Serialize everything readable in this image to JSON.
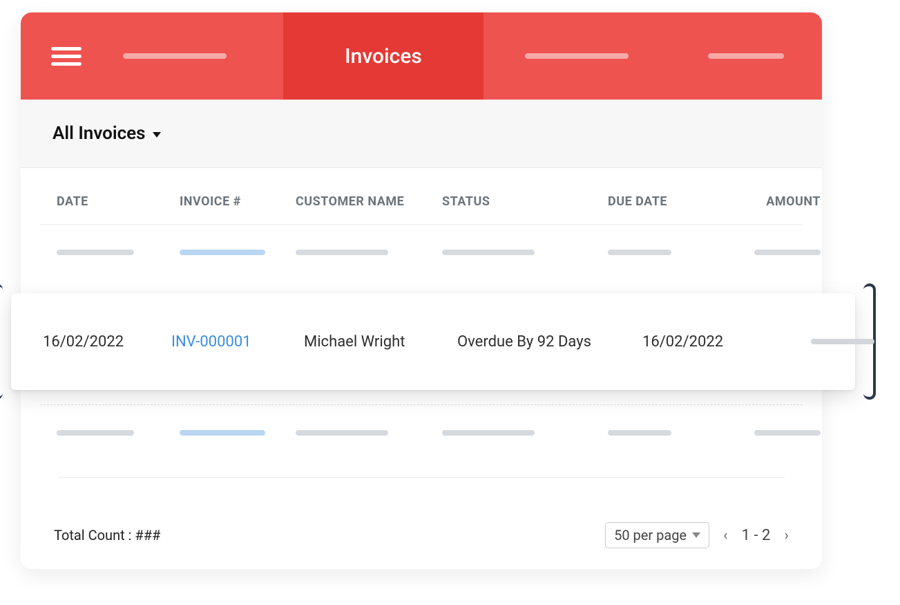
{
  "header": {
    "active_tab": "Invoices"
  },
  "filter": {
    "label": "All Invoices"
  },
  "columns": {
    "date": "DATE",
    "invoice": "INVOICE #",
    "customer": "CUSTOMER NAME",
    "status": "STATUS",
    "due_date": "DUE DATE",
    "amount": "AMOUNT"
  },
  "highlighted_row": {
    "date": "16/02/2022",
    "invoice": "INV-000001",
    "customer": "Michael Wright",
    "status": "Overdue By 92 Days",
    "due_date": "16/02/2022"
  },
  "footer": {
    "total_label": "Total Count : ###",
    "per_page": "50 per page",
    "range": "1 - 2"
  }
}
